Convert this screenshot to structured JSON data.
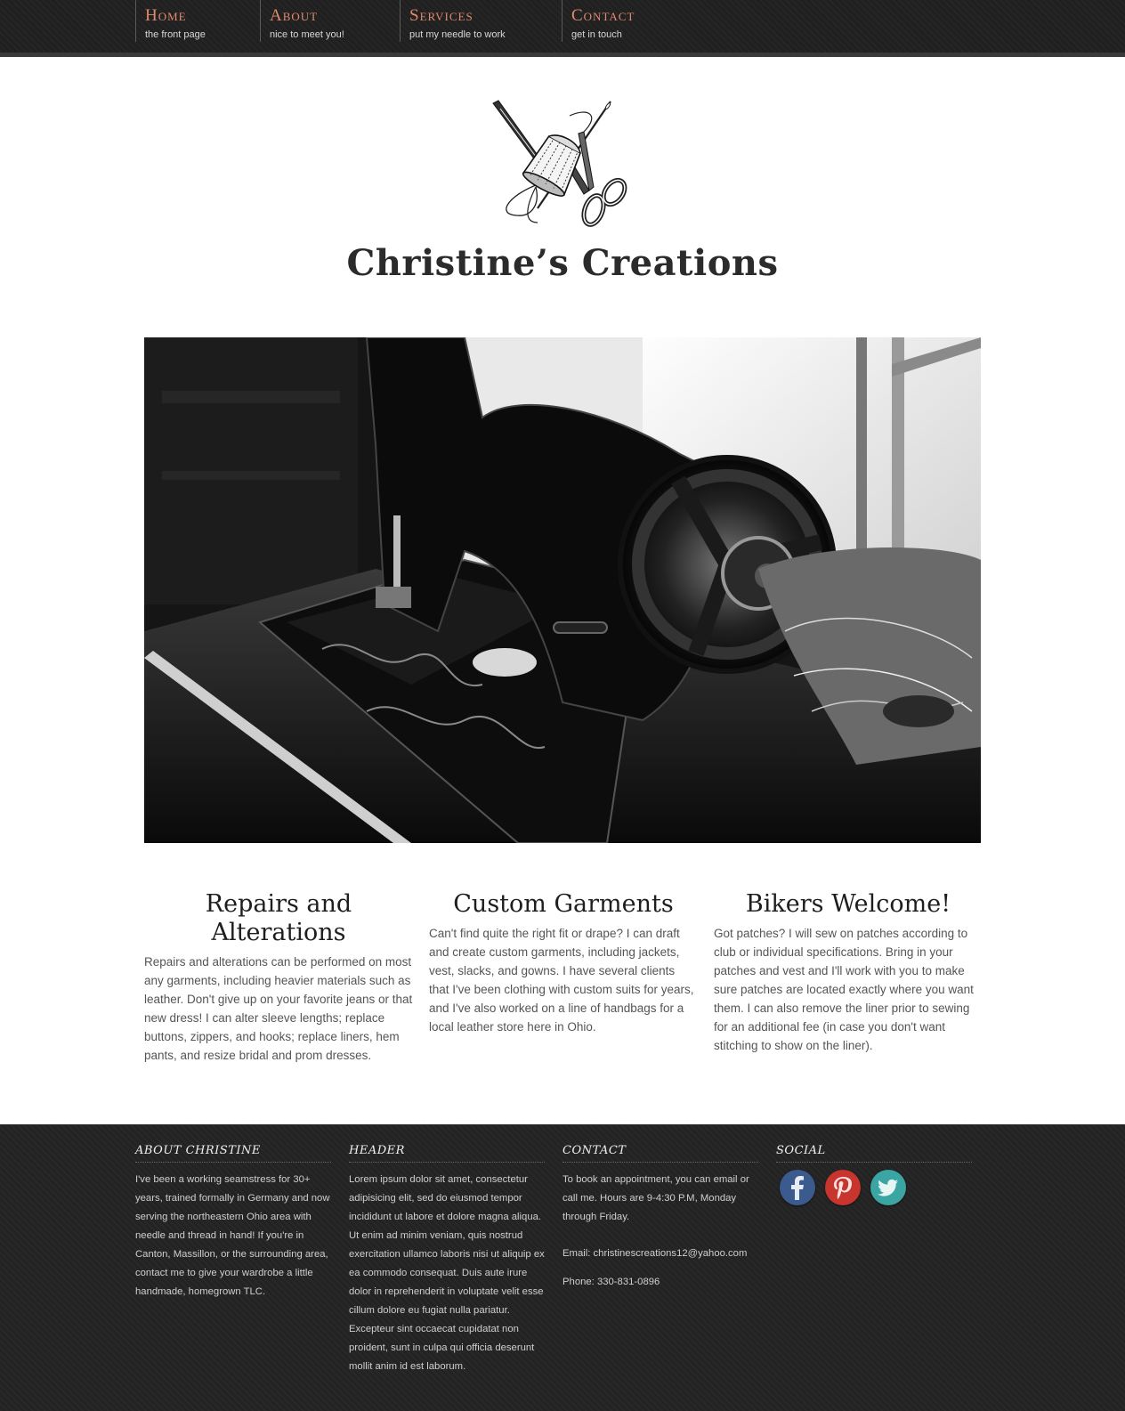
{
  "nav": [
    {
      "title": "Home",
      "subtitle": "the front page"
    },
    {
      "title": "About",
      "subtitle": "nice to meet you!"
    },
    {
      "title": "Services",
      "subtitle": "put my needle to work"
    },
    {
      "title": "Contact",
      "subtitle": "get in touch"
    }
  ],
  "site": {
    "title": "Christine’s Creations",
    "logo_icon": "sewing-notions-icon",
    "hero_image": "sewing-machine-photo"
  },
  "features": [
    {
      "heading": "Repairs and Alterations",
      "body": "Repairs and alterations can be performed on most any garments, including heavier materials such as leather. Don't give up on your favorite jeans or that new dress! I can alter sleeve lengths; replace buttons, zippers, and hooks; replace liners, hem pants, and resize bridal and prom dresses."
    },
    {
      "heading": "Custom Garments",
      "body": "Can't find quite the right fit or drape? I can draft and create custom garments, including jackets, vest, slacks, and gowns. I have several clients that I've been clothing with custom suits for years, and I've also worked on a line of handbags for a local leather store here in Ohio."
    },
    {
      "heading": "Bikers Welcome!",
      "body": "Got patches? I will sew on patches according to club or individual specifications. Bring in your patches and vest and I'll work with you to make sure patches are located exactly where you want them. I can also remove the liner prior to sewing for an additional fee (in case you don't want stitching to show on the liner)."
    }
  ],
  "footer": {
    "about": {
      "heading": "About Christine",
      "body": "I've been a working seamstress for 30+ years, trained formally in Germany and now serving the northeastern Ohio area with needle and thread in hand! If you're in Canton, Massillon, or the surrounding area, contact me to give your wardrobe a little handmade, homegrown TLC."
    },
    "header": {
      "heading": "Header",
      "body": "Lorem ipsum dolor sit amet, consectetur adipisicing elit, sed do eiusmod tempor incididunt ut labore et dolore magna aliqua. Ut enim ad minim veniam, quis nostrud exercitation ullamco laboris nisi ut aliquip ex ea commodo consequat. Duis aute irure dolor in reprehenderit in voluptate velit esse cillum dolore eu fugiat nulla pariatur. Excepteur sint occaecat cupidatat non proident, sunt in culpa qui officia deserunt mollit anim id est laborum."
    },
    "contact": {
      "heading": "Contact",
      "body": "To book an appointment, you can email or call me. Hours are 9-4:30 P.M, Monday through Friday.",
      "email": "Email: christinescreations12@yahoo.com",
      "phone": "Phone: 330-831-0896"
    },
    "social": {
      "heading": "Social",
      "icons": [
        {
          "name": "facebook-icon",
          "glyph": "f",
          "color": "#3b5b8f"
        },
        {
          "name": "pinterest-icon",
          "glyph": "P",
          "color": "#c7352e"
        },
        {
          "name": "twitter-icon",
          "glyph": "t",
          "color": "#3aa5a3"
        }
      ]
    }
  }
}
